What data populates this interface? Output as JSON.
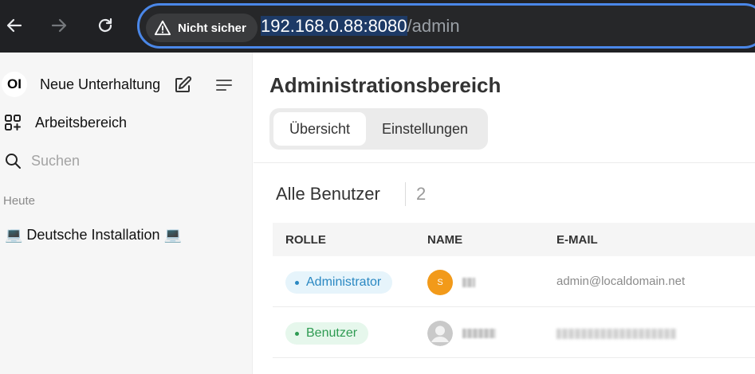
{
  "browser": {
    "security_label": "Nicht sicher",
    "url_host": "192.168.0.88:8080",
    "url_path": "/admin"
  },
  "sidebar": {
    "logo_text": "OI",
    "new_chat_label": "Neue Unterhaltung",
    "workspace_label": "Arbeitsbereich",
    "search_placeholder": "Suchen",
    "section_today": "Heute",
    "chat_items": [
      {
        "label": "💻 Deutsche Installation 💻"
      }
    ]
  },
  "main": {
    "title": "Administrationsbereich",
    "tabs": [
      {
        "label": "Übersicht",
        "active": true
      },
      {
        "label": "Einstellungen",
        "active": false
      }
    ],
    "users_title": "Alle Benutzer",
    "users_count": "2",
    "table": {
      "headers": [
        "ROLLE",
        "NAME",
        "E-MAIL"
      ],
      "rows": [
        {
          "role": "Administrator",
          "avatar_letter": "S",
          "email": "admin@localdomain.net"
        },
        {
          "role": "Benutzer",
          "avatar_letter": "",
          "email": ""
        }
      ]
    }
  },
  "colors": {
    "accent_blue": "#4a87e8",
    "admin_badge": "#2a88c2",
    "user_badge": "#2e9b52",
    "avatar_orange": "#f29a1a"
  }
}
